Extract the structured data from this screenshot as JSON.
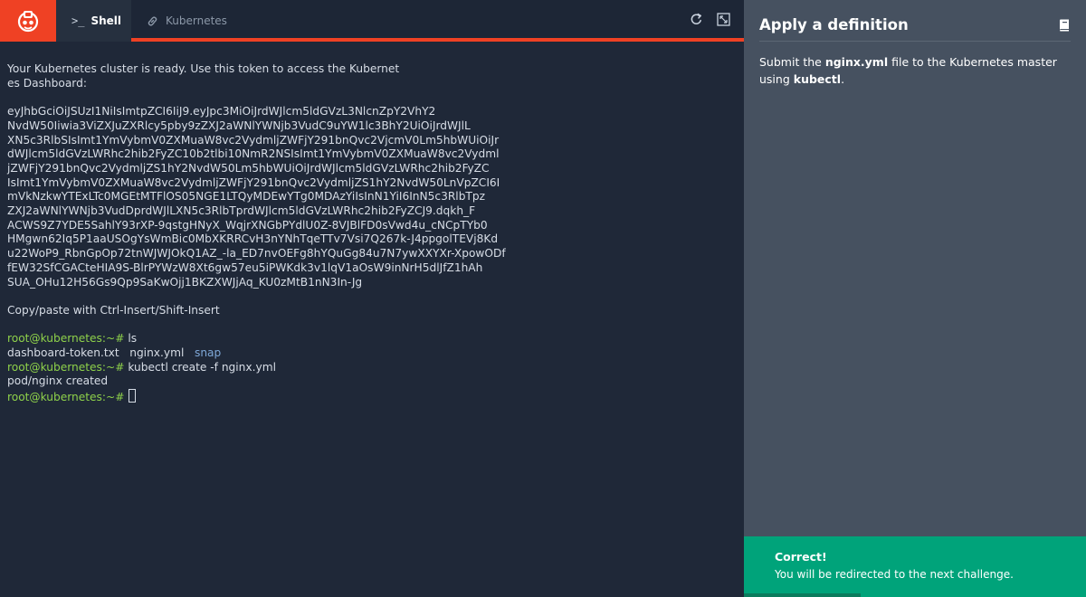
{
  "tabs": {
    "shell_glyph": ">_",
    "shell_label": "Shell",
    "kubernetes_label": "Kubernetes"
  },
  "toolbar_icons": [
    "refresh-icon",
    "expand-icon"
  ],
  "terminal": {
    "lines": [
      "Your Kubernetes cluster is ready. Use this token to access the Kubernet",
      "es Dashboard:",
      "",
      "eyJhbGciOiJSUzI1NiIsImtpZCI6IiJ9.eyJpc3MiOiJrdWJlcm5ldGVzL3NlcnZpY2VhY2",
      "NvdW50Iiwia3ViZXJuZXRlcy5pby9zZXJ2aWNlYWNjb3VudC9uYW1lc3BhY2UiOiJrdWJlL",
      "XN5c3RlbSIsImt1YmVybmV0ZXMuaW8vc2VydmljZWFjY291bnQvc2VjcmV0Lm5hbWUiOiJr",
      "dWJlcm5ldGVzLWRhc2hib2FyZC10b2tlbi10NmR2NSIsImt1YmVybmV0ZXMuaW8vc2Vydml",
      "jZWFjY291bnQvc2VydmljZS1hY2NvdW50Lm5hbWUiOiJrdWJlcm5ldGVzLWRhc2hib2FyZC",
      "IsImt1YmVybmV0ZXMuaW8vc2VydmljZWFjY291bnQvc2VydmljZS1hY2NvdW50LnVpZCI6I",
      "mVkNzkwYTExLTc0MGEtMTFlOS05NGE1LTQyMDEwYTg0MDAzYiIsInN1YiI6InN5c3RlbTpz",
      "ZXJ2aWNlYWNjb3VudDprdWJlLXN5c3RlbTprdWJlcm5ldGVzLWRhc2hib2FyZCJ9.dqkh_F",
      "ACWS9Z7YDE5SahlY93rXP-9qstgHNyX_WqjrXNGbPYdlU0Z-8VJBlFD0sVwd4u_cNCpTYb0",
      "HMgwn62Iq5P1aaUSOgYsWmBic0MbXKRRCvH3nYNhTqeTTv7Vsi7Q267k-J4ppgolTEVj8Kd",
      "u22WoP9_RbnGpOp72tnWJWJOkQ1AZ_-la_ED7nvOEFg8hYQuGg84u7N7ywXXYXr-XpowODf",
      "fEW32SfCGACteHIA9S-BlrPYWzW8Xt6gw57eu5iPWKdk3v1lqV1aOsW9inNrH5dlJfZ1hAh",
      "SUA_OHu12H56Gs9Qp9SaKwOjj1BKZXWJjAq_KU0zMtB1nN3In-Jg",
      "",
      "Copy/paste with Ctrl-Insert/Shift-Insert",
      ""
    ],
    "prompt": "root@kubernetes:~#",
    "cmd1": "ls",
    "ls_files": "dashboard-token.txt   nginx.yml   ",
    "ls_dir": "snap",
    "cmd2": "kubectl create -f nginx.yml",
    "output2": "pod/nginx created"
  },
  "panel": {
    "title": "Apply a definition",
    "text_pre": "Submit the ",
    "file_name": "nginx.yml",
    "text_mid": " file to the Kubernetes master using ",
    "tool_name": "kubectl",
    "text_post": "."
  },
  "success": {
    "title": "Correct!",
    "message": "You will be redirected to the next challenge.",
    "progress": 0.34
  },
  "colors": {
    "accent": "#ef4124",
    "success": "#00a37a",
    "prompt": "#8ed14a",
    "directory": "#7ea8d8"
  }
}
